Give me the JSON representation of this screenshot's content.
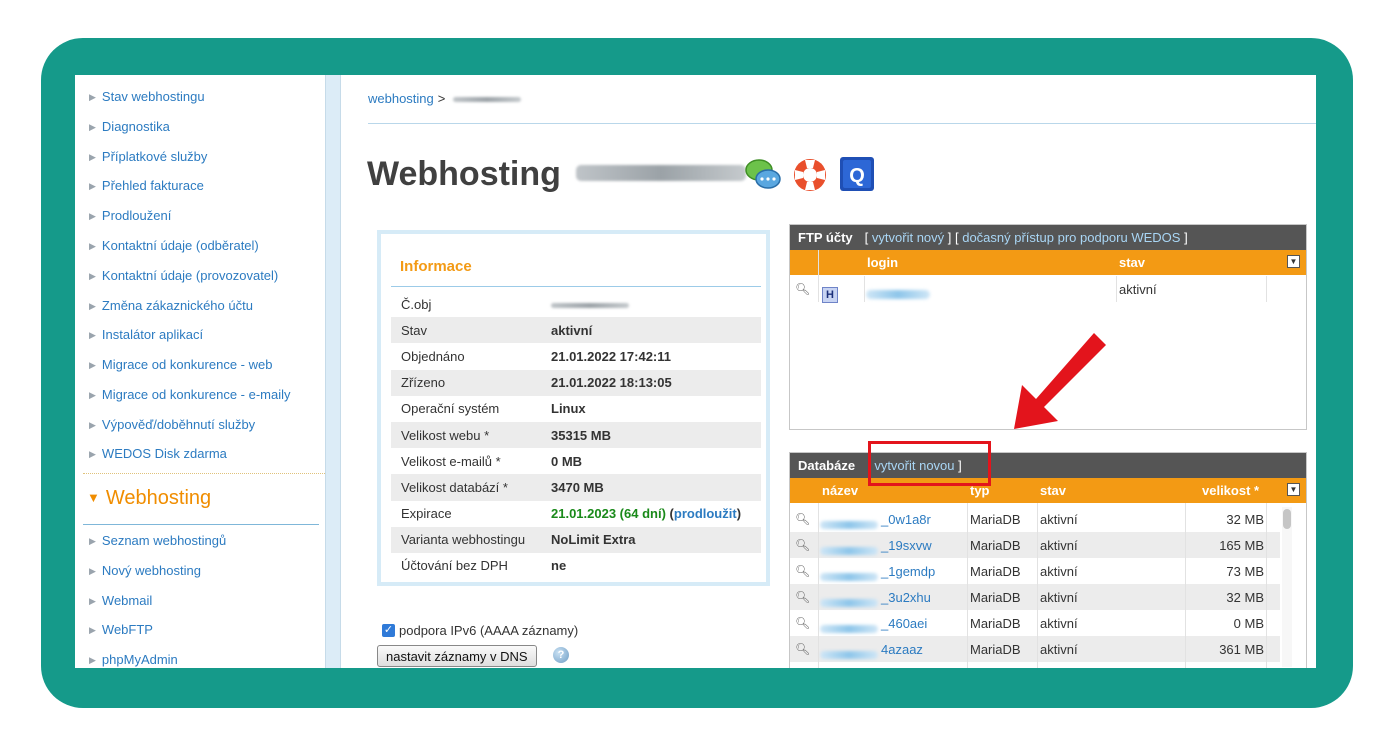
{
  "sidebar": {
    "items": [
      "Stav webhostingu",
      "Diagnostika",
      "Příplatkové služby",
      "Přehled fakturace",
      "Prodloužení",
      "Kontaktní údaje (odběratel)",
      "Kontaktní údaje (provozovatel)",
      "Změna zákaznického účtu",
      "Instalátor aplikací",
      "Migrace od konkurence - web",
      "Migrace od konkurence - e-maily",
      "Výpověď/doběhnutí služby",
      "WEDOS Disk zdarma"
    ],
    "section_title": "Webhosting",
    "section_items": [
      "Seznam webhostingů",
      "Nový webhosting",
      "Webmail",
      "WebFTP",
      "phpMyAdmin"
    ]
  },
  "breadcrumb": {
    "root": "webhosting",
    "separator": ">"
  },
  "page_title": "Webhosting",
  "title_icons": [
    "chat-icon",
    "lifebuoy-icon",
    "quick-q-icon"
  ],
  "info": {
    "title": "Informace",
    "rows": [
      {
        "label": "Č.obj",
        "value": ""
      },
      {
        "label": "Stav",
        "value": "aktivní"
      },
      {
        "label": "Objednáno",
        "value": "21.01.2022 17:42:11"
      },
      {
        "label": "Zřízeno",
        "value": "21.01.2022 18:13:05"
      },
      {
        "label": "Operační systém",
        "value": "Linux"
      },
      {
        "label": "Velikost webu *",
        "value": "35315 MB"
      },
      {
        "label": "Velikost e-mailů *",
        "value": "0 MB"
      },
      {
        "label": "Velikost databází *",
        "value": "3470 MB"
      },
      {
        "label": "Expirace",
        "value": "21.01.2023 (64 dní)",
        "extend_link": "prodloužit",
        "open": "(",
        "close": ")"
      },
      {
        "label": "Varianta webhostingu",
        "value": "NoLimit Extra"
      },
      {
        "label": "Účtování bez DPH",
        "value": "ne"
      }
    ]
  },
  "ipv6": {
    "checkbox_label": "podpora IPv6 (AAAA záznamy)",
    "checked": true,
    "dns_button": "nastavit záznamy v DNS"
  },
  "ftp": {
    "title": "FTP účty",
    "create_link": "vytvořit nový",
    "support_link": "dočasný přístup pro podporu WEDOS",
    "columns": [
      "login",
      "stav"
    ],
    "rows": [
      {
        "badge": "H",
        "status": "aktivní"
      }
    ]
  },
  "db": {
    "title": "Databáze",
    "create_link": "vytvořit novou",
    "columns": [
      "název",
      "typ",
      "stav",
      "velikost *"
    ],
    "rows": [
      {
        "name": "_0w1a8r",
        "type": "MariaDB",
        "status": "aktivní",
        "size": "32 MB"
      },
      {
        "name": "_19sxvw",
        "type": "MariaDB",
        "status": "aktivní",
        "size": "165 MB"
      },
      {
        "name": "_1gemdp",
        "type": "MariaDB",
        "status": "aktivní",
        "size": "73 MB"
      },
      {
        "name": "_3u2xhu",
        "type": "MariaDB",
        "status": "aktivní",
        "size": "32 MB"
      },
      {
        "name": "_460aei",
        "type": "MariaDB",
        "status": "aktivní",
        "size": "0 MB"
      },
      {
        "name": "4azaaz",
        "type": "MariaDB",
        "status": "aktivní",
        "size": "361 MB"
      }
    ]
  },
  "colors": {
    "frame": "#159a8a",
    "accent": "#f39a14",
    "link": "#2c7bc1",
    "annotation": "#e3141c",
    "active": "#1a8a1a"
  }
}
